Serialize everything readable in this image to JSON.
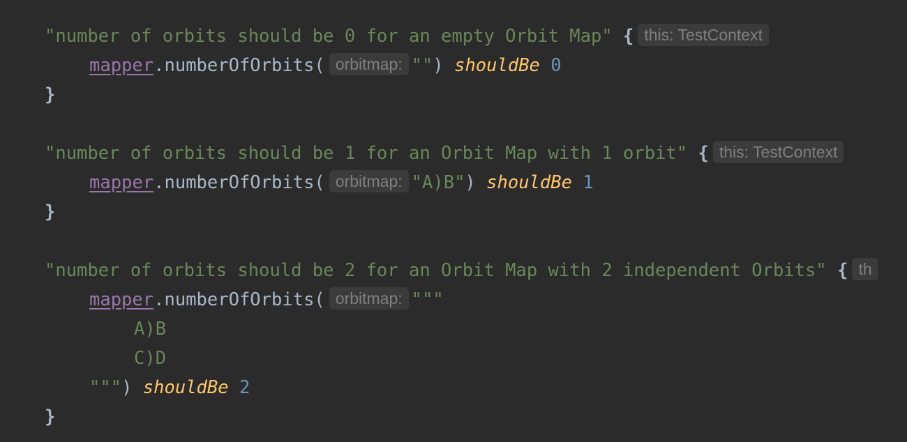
{
  "code": {
    "test1": {
      "title": "\"number of orbits should be 0 for an empty Orbit Map\"",
      "open_brace": "{",
      "receiver_hint": "this: TestContext",
      "receiver": "mapper",
      "dot": ".",
      "call": "numberOfOrbits(",
      "param_hint": "orbitmap:",
      "arg": "\"\"",
      "close_paren": ")",
      "infix": "shouldBe",
      "expected": "0",
      "close_brace": "}"
    },
    "test2": {
      "title": "\"number of orbits should be 1 for an Orbit Map with 1 orbit\"",
      "open_brace": "{",
      "receiver_hint": "this: TestContext",
      "receiver": "mapper",
      "dot": ".",
      "call": "numberOfOrbits(",
      "param_hint": "orbitmap:",
      "arg": "\"A)B\"",
      "close_paren": ")",
      "infix": "shouldBe",
      "expected": "1",
      "close_brace": "}"
    },
    "test3": {
      "title": "\"number of orbits should be 2 for an Orbit Map with 2 independent Orbits\"",
      "open_brace": "{",
      "receiver_hint": "th",
      "receiver": "mapper",
      "dot": ".",
      "call": "numberOfOrbits(",
      "param_hint": "orbitmap:",
      "arg_open": "\"\"\"",
      "arg_lines": [
        "A)B",
        "C)D"
      ],
      "arg_close": "\"\"\"",
      "close_paren": ")",
      "infix": "shouldBe",
      "expected": "2",
      "close_brace": "}"
    }
  },
  "colors": {
    "background": "#2b2b2b",
    "string": "#6a8759",
    "property": "#9876aa",
    "default_text": "#a9b7c6",
    "keyword_call": "#ffc66d",
    "number": "#6897bb",
    "hint_text": "#7f7f7f",
    "hint_background": "#3b3b3b"
  }
}
